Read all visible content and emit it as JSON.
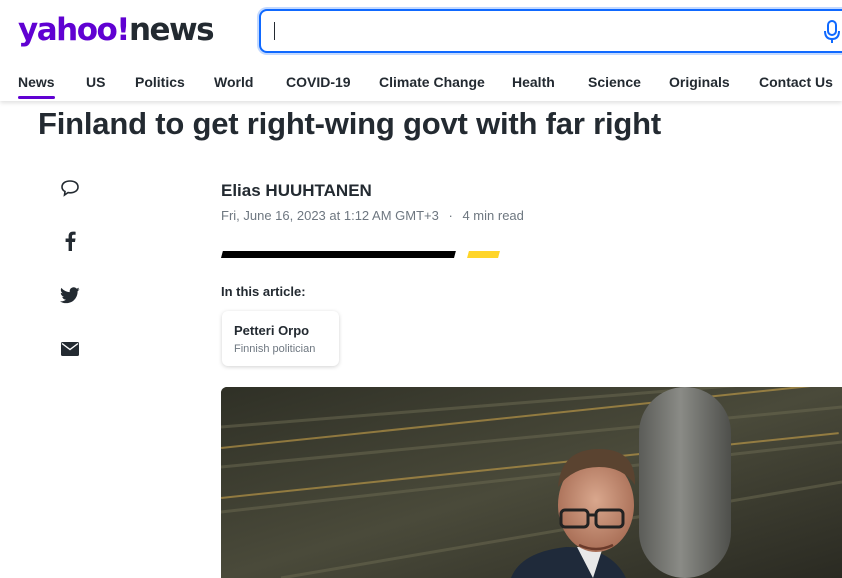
{
  "header": {
    "logo_brand": "yahoo!",
    "logo_section": "news",
    "search_placeholder": ""
  },
  "nav": {
    "items": [
      {
        "label": "News",
        "active": true
      },
      {
        "label": "US"
      },
      {
        "label": "Politics"
      },
      {
        "label": "World"
      },
      {
        "label": "COVID-19"
      },
      {
        "label": "Climate Change"
      },
      {
        "label": "Health"
      },
      {
        "label": "Science"
      },
      {
        "label": "Originals"
      },
      {
        "label": "Contact Us"
      }
    ]
  },
  "article": {
    "title": "Finland to get right-wing govt with far right",
    "author": "Elias HUUHTANEN",
    "date": "Fri, June 16, 2023 at 1:12 AM GMT+3",
    "separator": "·",
    "read_time": "4 min read",
    "in_this_article_label": "In this article:",
    "entity": {
      "name": "Petteri Orpo",
      "description": "Finnish politician"
    }
  },
  "share": {
    "icons": [
      "comment-icon",
      "facebook-icon",
      "twitter-icon",
      "mail-icon"
    ]
  },
  "colors": {
    "brand": "#6001d2",
    "search_focus": "#0f69ff",
    "accent_yellow": "#ffd529"
  }
}
